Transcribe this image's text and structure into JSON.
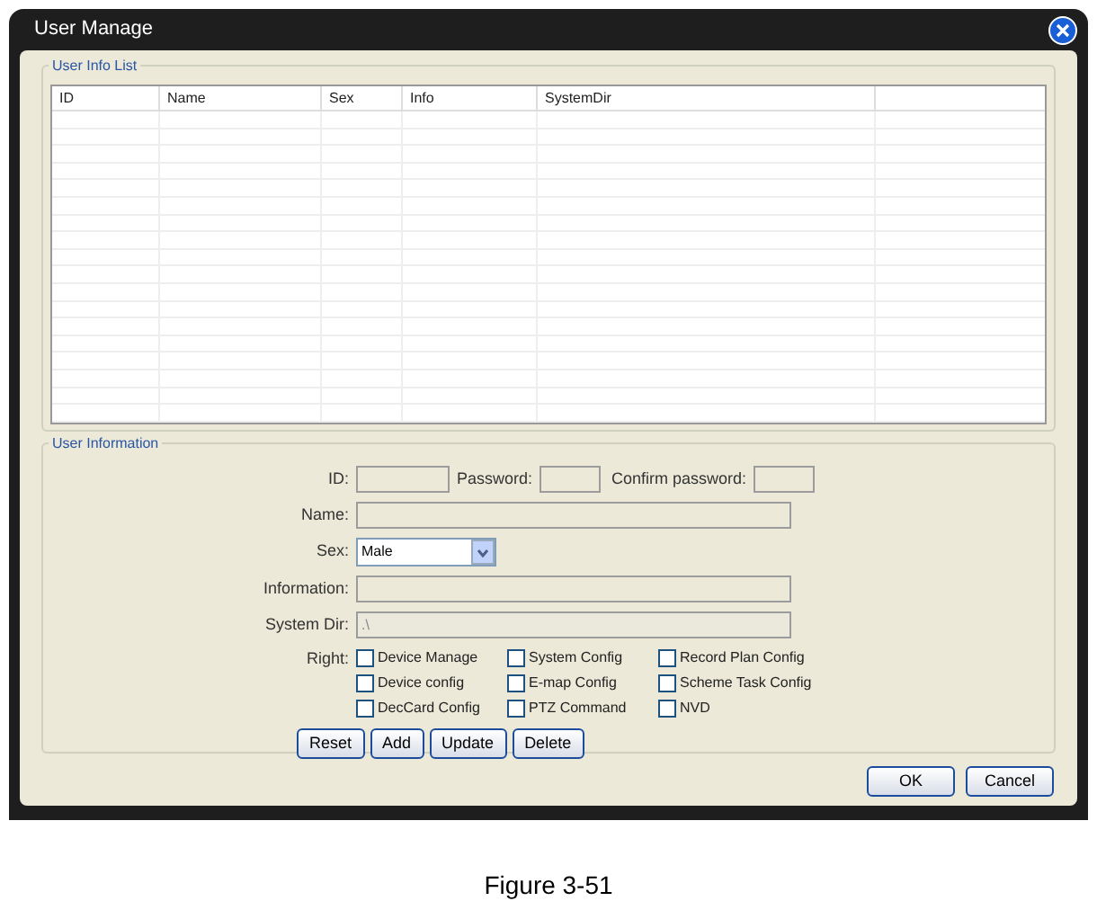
{
  "window": {
    "title": "User Manage"
  },
  "list_group": {
    "title": "User Info List",
    "columns": [
      "ID",
      "Name",
      "Sex",
      "Info",
      "SystemDir"
    ]
  },
  "info_group": {
    "title": "User Information",
    "id": {
      "label": "ID:"
    },
    "password": {
      "label": "Password:"
    },
    "confirm": {
      "label": "Confirm password:"
    },
    "name": {
      "label": "Name:"
    },
    "sex": {
      "label": "Sex:",
      "value": "Male"
    },
    "information": {
      "label": "Information:"
    },
    "system_dir": {
      "label": "System Dir:",
      "value": ".\\"
    },
    "right": {
      "label": "Right:",
      "options": [
        {
          "label": "Device Manage",
          "checked": false
        },
        {
          "label": "System Config",
          "checked": false
        },
        {
          "label": "Record Plan Config",
          "checked": false
        },
        {
          "label": "Device config",
          "checked": false
        },
        {
          "label": "E-map Config",
          "checked": false
        },
        {
          "label": "Scheme Task Config",
          "checked": false
        },
        {
          "label": "DecCard Config",
          "checked": false
        },
        {
          "label": "PTZ Command",
          "checked": false
        },
        {
          "label": "NVD",
          "checked": false
        }
      ]
    },
    "actions": [
      "Reset",
      "Add",
      "Update",
      "Delete"
    ]
  },
  "buttons": [
    "OK",
    "Cancel"
  ],
  "caption": "Figure 3-51"
}
